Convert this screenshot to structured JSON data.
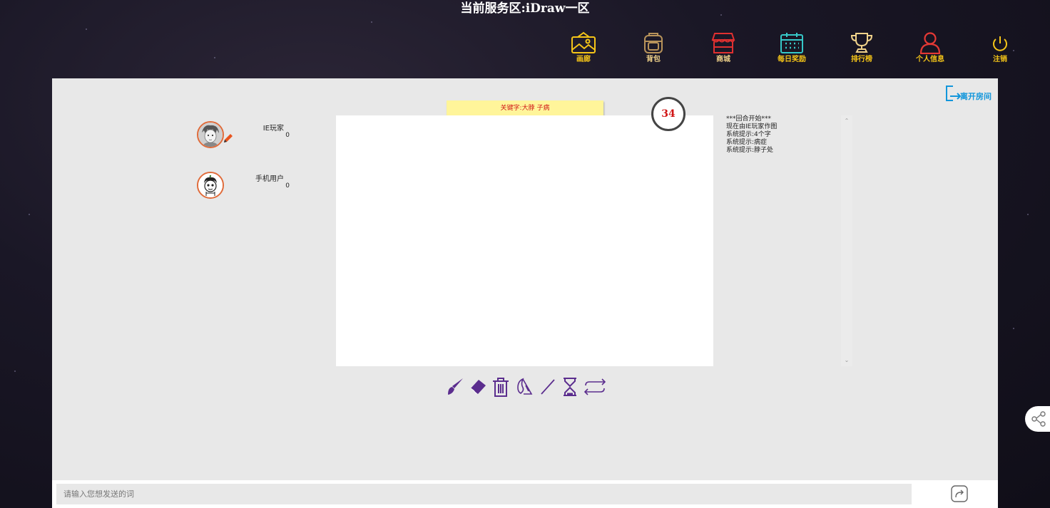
{
  "header": {
    "server_title": "当前服务区:iDraw一区"
  },
  "nav": [
    {
      "label": "画廊",
      "icon": "gallery-icon",
      "color": "#f5c518"
    },
    {
      "label": "背包",
      "icon": "backpack-icon",
      "color": "#b8935a"
    },
    {
      "label": "商城",
      "icon": "shop-icon",
      "color": "#e03030"
    },
    {
      "label": "每日奖励",
      "icon": "calendar-icon",
      "color": "#36c8c8"
    },
    {
      "label": "排行榜",
      "icon": "trophy-icon",
      "color": "#f0d28a"
    },
    {
      "label": "个人信息",
      "icon": "user-icon",
      "color": "#e53935"
    },
    {
      "label": "注销",
      "icon": "power-icon",
      "color": "#f5c518"
    }
  ],
  "room": {
    "leave_label": "离开房间",
    "keyword": "关键字:大脖 子病",
    "timer": "34",
    "players": [
      {
        "name": "IE玩家",
        "score": "0",
        "drawing": true
      },
      {
        "name": "手机用户",
        "score": "0",
        "drawing": false
      }
    ],
    "log": [
      "***回合开始***",
      "现在由IE玩家作图",
      "系统提示:4个字",
      "系统提示:病症",
      "系统提示:脖子处"
    ]
  },
  "tools": [
    "brush-icon",
    "eraser-icon",
    "trash-icon",
    "fill-icon",
    "line-icon",
    "hourglass-icon",
    "swap-icon"
  ],
  "chat": {
    "placeholder": "请输入您想发送的词"
  },
  "colors": {
    "accent": "#5b2d8e",
    "panel": "#e8e8e8",
    "avatar_border": "#e06b3a"
  }
}
